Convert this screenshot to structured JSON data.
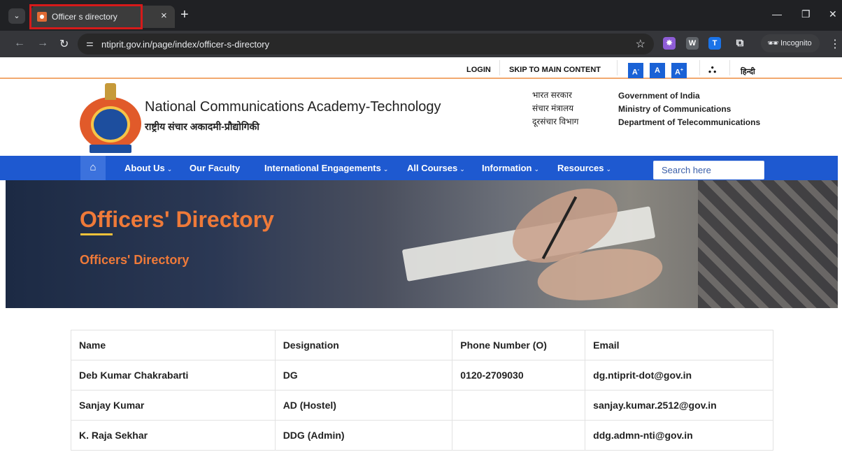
{
  "browser": {
    "tab_title": "Officer s directory",
    "url": "ntiprit.gov.in/page/index/officer-s-directory",
    "incognito_label": "Incognito",
    "extensions": [
      {
        "name": "puzzle-extension",
        "glyph": "✸",
        "color": "#8e5dd6"
      },
      {
        "name": "w-extension",
        "glyph": "W",
        "color": "#5f6368"
      },
      {
        "name": "t-extension",
        "glyph": "T",
        "color": "#1a73e8"
      }
    ]
  },
  "topbar": {
    "login": "LOGIN",
    "skip": "SKIP TO MAIN CONTENT",
    "font_small": "A-",
    "font_normal": "A",
    "font_large": "A+",
    "language": "हिन्दी"
  },
  "header": {
    "org_name_en": "National Communications Academy-Technology",
    "org_name_hi": "राष्ट्रीय संचार अकादमी-प्रौद्योगिकी",
    "gov_hi": [
      "भारत सरकार",
      "संचार मंत्रालय",
      "दूरसंचार विभाग"
    ],
    "gov_en": [
      "Government of India",
      "Ministry of Communications",
      "Department of Telecommunications"
    ]
  },
  "nav": {
    "items": [
      "About Us",
      "Our Faculty",
      "International Engagements",
      "All Courses",
      "Information",
      "Resources"
    ],
    "search_placeholder": "Search here"
  },
  "banner": {
    "title": "Officers' Directory",
    "breadcrumb": "Officers' Directory"
  },
  "table": {
    "headers": [
      "Name",
      "Designation",
      "Phone Number (O)",
      "Email"
    ],
    "rows": [
      [
        "Deb Kumar Chakrabarti",
        "DG",
        "0120-2709030",
        "dg.ntiprit-dot@gov.in"
      ],
      [
        "Sanjay Kumar",
        "AD (Hostel)",
        "",
        "sanjay.kumar.2512@gov.in"
      ],
      [
        "K. Raja Sekhar",
        "DDG (Admin)",
        "",
        "ddg.admn-nti@gov.in"
      ]
    ]
  },
  "colors": {
    "nav_blue": "#1e59d0",
    "accent_orange": "#ef7a39",
    "tab_highlight": "#d61a1a"
  }
}
